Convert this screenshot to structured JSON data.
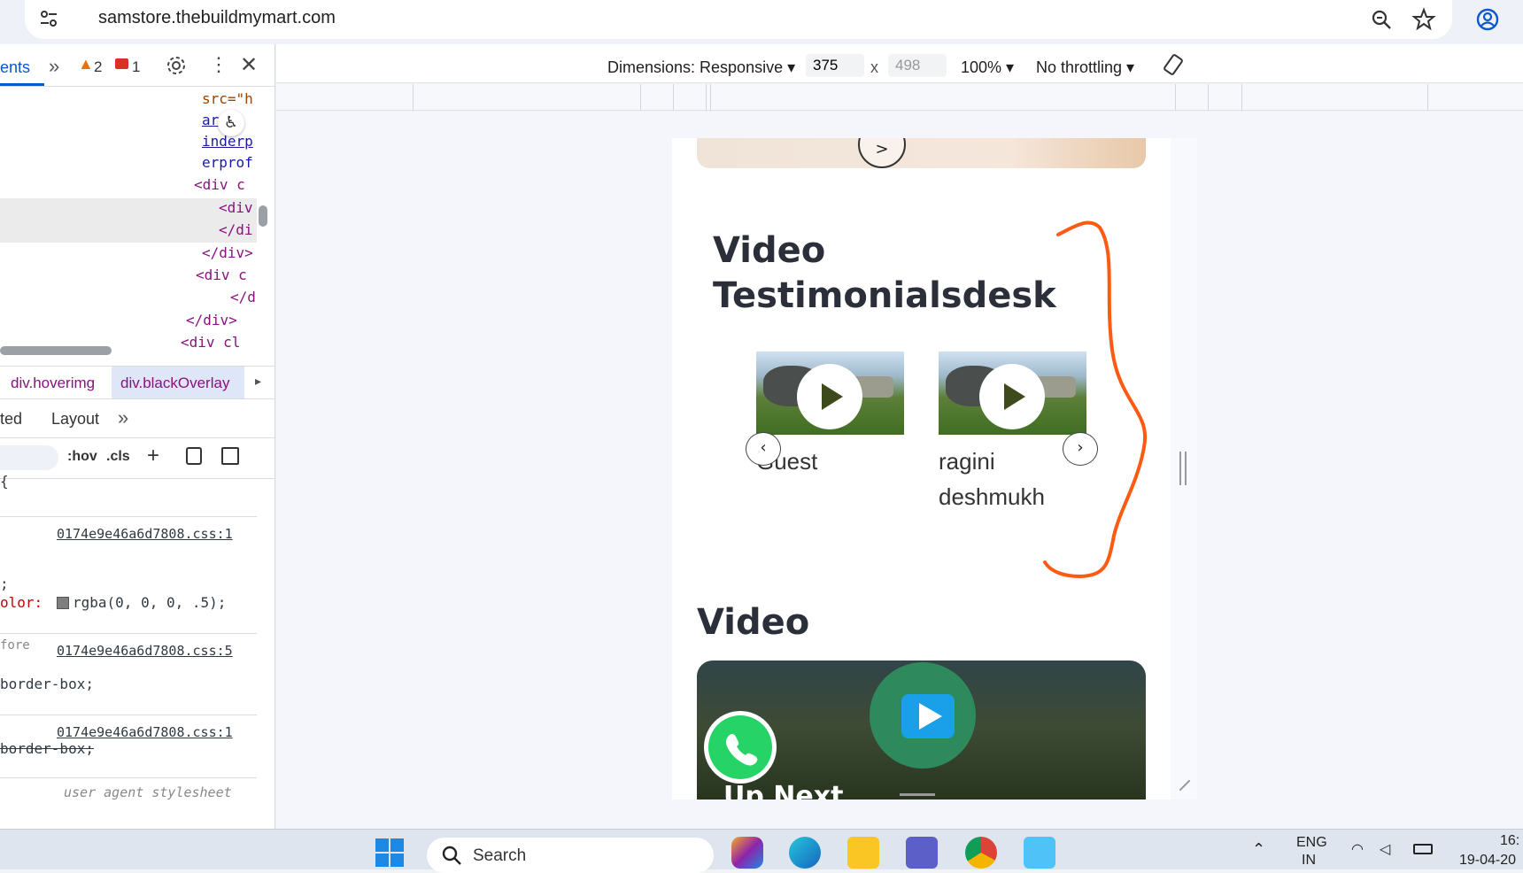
{
  "browser": {
    "url": "samstore.thebuildmymart.com"
  },
  "devtools": {
    "active_tab": "ents",
    "warnings": "2",
    "errors": "1",
    "code_lines": [
      "src=\"h",
      "ar o",
      "inderp",
      "erprof",
      "<div c",
      "<div",
      "</di",
      "</div>",
      "<div c",
      "</d",
      "</div>",
      "<div cl"
    ],
    "breadcrumbs": [
      "div.hoverimg",
      "div.blackOverlay"
    ],
    "styles_tabs": [
      "ted",
      "Layout"
    ],
    "filter_buttons": [
      ":hov",
      ".cls"
    ],
    "rule_sources": [
      "0174e9e46a6d7808.css:1",
      "0174e9e46a6d7808.css:5",
      "0174e9e46a6d7808.css:1"
    ],
    "props": [
      ";",
      "olor:",
      "rgba(0, 0, 0, .5);",
      "fore",
      "border-box;",
      "border-box;",
      "user agent stylesheet"
    ]
  },
  "device_toolbar": {
    "dimensions_label": "Dimensions: Responsive ▾",
    "width": "375",
    "x_sep": "x",
    "height": "498",
    "zoom": "100% ▾",
    "throttling": "No throttling ▾"
  },
  "page": {
    "banner_next": ">",
    "section_title": "Video Testimonialsdesk",
    "testimonials": [
      {
        "name": "Guest"
      },
      {
        "name": "ragini deshmukh"
      }
    ],
    "prev_arrow": "‹",
    "next_arrow": "›",
    "video_heading": "Video",
    "up_next": "Up Next"
  },
  "taskbar": {
    "search_placeholder": "Search",
    "lang_line1": "ENG",
    "lang_line2": "IN",
    "time": "16:",
    "date": "19-04-20"
  }
}
